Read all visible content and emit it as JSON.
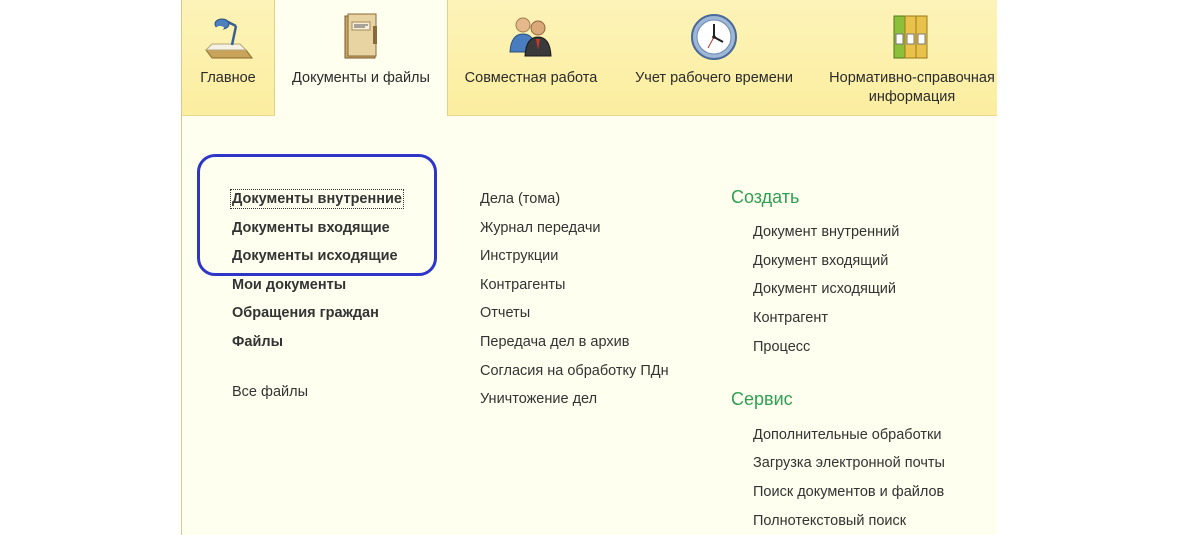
{
  "tabs": [
    {
      "label": "Главное",
      "icon": "desk-lamp-icon"
    },
    {
      "label": "Документы и файлы",
      "icon": "document-folder-icon",
      "active": true
    },
    {
      "label": "Совместная работа",
      "icon": "people-icon"
    },
    {
      "label": "Учет рабочего времени",
      "icon": "clock-icon"
    },
    {
      "label": "Нормативно-справочная информация",
      "icon": "binders-icon"
    }
  ],
  "col1": {
    "items": [
      "Документы внутренние",
      "Документы входящие",
      "Документы исходящие",
      "Мои документы",
      "Обращения граждан",
      "Файлы"
    ],
    "extra": "Все файлы"
  },
  "col2": {
    "items": [
      "Дела (тома)",
      "Журнал передачи",
      "Инструкции",
      "Контрагенты",
      "Отчеты",
      "Передача дел в архив",
      "Согласия на обработку ПДн",
      "Уничтожение дел"
    ]
  },
  "create": {
    "title": "Создать",
    "items": [
      "Документ внутренний",
      "Документ входящий",
      "Документ исходящий",
      "Контрагент",
      "Процесс"
    ]
  },
  "service": {
    "title": "Сервис",
    "items": [
      "Дополнительные обработки",
      "Загрузка электронной почты",
      "Поиск документов и файлов",
      "Полнотекстовый поиск"
    ]
  },
  "colors": {
    "section": "#2f9f53",
    "highlight": "#2e36c8",
    "tabbar": "#fbeea0"
  }
}
